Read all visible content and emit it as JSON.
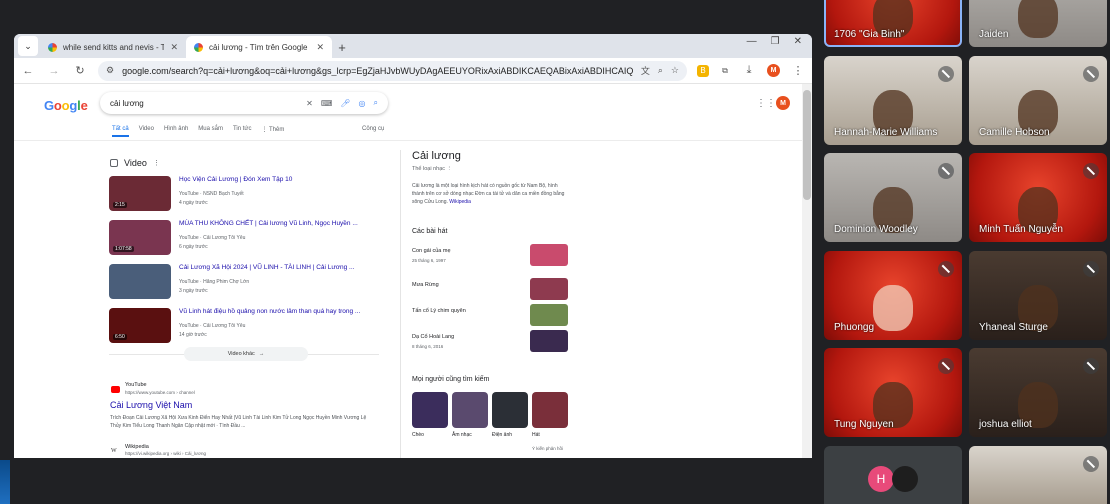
{
  "tabs": [
    {
      "title": "while send kitts and nevis - Tìm",
      "active": false
    },
    {
      "title": "cải lương - Tìm trên Google",
      "active": true
    }
  ],
  "url": "google.com/search?q=cải+lương&oq=cải+lương&gs_lcrp=EgZjaHJvbWUyDAgAEEUYORixAxiABDIKCAEQABixAxiABDIHCAIQABiA...",
  "google": {
    "logo": "Google",
    "query": "cải lương",
    "avatar": "M",
    "tabs": [
      "Tất cả",
      "Video",
      "Hình ảnh",
      "Mua sắm",
      "Tin tức",
      "⋮ Thêm"
    ],
    "tools": "Công cụ"
  },
  "videos": {
    "heading": "Video",
    "items": [
      {
        "title": "Học Viện Cải Lương | Đón Xem Tập 10",
        "source": "YouTube · NSND Bạch Tuyết",
        "date": "4 ngày trước",
        "duration": "2:15",
        "color": "#6b2a35"
      },
      {
        "title": "MÙA THU KHÔNG CHẾT | Cải lương Vũ Linh, Ngọc Huyền ...",
        "source": "YouTube · Cải Lương Tôi Yêu",
        "date": "6 ngày trước",
        "duration": "1:07:58",
        "color": "#7a3550"
      },
      {
        "title": "Cải Lương Xã Hội 2024 | VŨ LINH - TÀI LINH | Cải Lương ...",
        "source": "YouTube · Hãng Phim Chợ Lớn",
        "date": "3 ngày trước",
        "duration": "",
        "color": "#4a5e7a"
      },
      {
        "title": "Vũ Linh hát điệu hồ quảng non nước lâm than quá hay trong ...",
        "source": "YouTube · Cải Lương Tôi Yêu",
        "date": "14 giờ trước",
        "duration": "6:50",
        "color": "#5a1010"
      }
    ],
    "more": "Video khác"
  },
  "result_youtube": {
    "source": "YouTube",
    "url": "https://www.youtube.com › channel",
    "title": "Cải Lương Việt Nam",
    "snippet": "Trích Đoạn Cải Lương Xã Hội Xưa Kinh Điển Hay Nhất |Vũ Linh Tài Linh Kim Tử Long Ngọc Huyền Minh Vương Lệ Thủy Kim Tiểu Long Thanh Ngân Cập nhật mới · Tình Đầu ..."
  },
  "result_wiki": {
    "source": "Wikipedia",
    "url": "https://vi.wikipedia.org › wiki › Cải_lương"
  },
  "knowledge": {
    "title": "Cải lương",
    "subtitle": "Thể loại nhạc ⋮",
    "description": "Cải lương là một loại hình kịch hát có nguồn gốc từ Nam Bộ, hình thành trên cơ sở dòng nhạc Đờn ca tài tử và dân ca miền đồng bằng sông Cửu Long.",
    "wiki_link": "Wikipedia",
    "songs_heading": "Các bài hát",
    "songs": [
      {
        "name": "Con gái của mẹ",
        "date": "25 tháng 6, 1997",
        "color": "#c94b6d"
      },
      {
        "name": "Mưa Rừng",
        "date": "",
        "color": "#8e3a4f"
      },
      {
        "name": "Tấn cổ Lý chim quyên",
        "date": "",
        "color": "#6f8a4e"
      },
      {
        "name": "Dạ Cổ Hoài Lang",
        "date": "8 tháng 6, 2016",
        "color": "#3a2a4f"
      }
    ],
    "people_heading": "Mọi người cũng tìm kiếm",
    "people": [
      {
        "name": "Chèo",
        "color": "#3b2d5c"
      },
      {
        "name": "Âm nhạc",
        "color": "#5a4a6e"
      },
      {
        "name": "Điện ảnh",
        "color": "#2b2f36"
      },
      {
        "name": "Hát",
        "color": "#7a2f3a"
      }
    ],
    "more": "Ý kiến phản hồi"
  },
  "participants": [
    {
      "name": "1706 \"Gia Binh\"",
      "muted": false,
      "bg": "red-bg",
      "selected": true
    },
    {
      "name": "Jaiden",
      "muted": false,
      "bg": "gray-bg",
      "selected": false
    },
    {
      "name": "Hannah-Marie Williams",
      "muted": true,
      "bg": "room-bg",
      "selected": false
    },
    {
      "name": "Camille Hobson",
      "muted": true,
      "bg": "room-bg",
      "selected": false
    },
    {
      "name": "Dominion Woodley",
      "muted": true,
      "bg": "gray-bg",
      "selected": false
    },
    {
      "name": "Minh Tuấn Nguyễn",
      "muted": true,
      "bg": "red-bg",
      "selected": false
    },
    {
      "name": "Phuongg",
      "muted": true,
      "bg": "red-bg",
      "selected": false
    },
    {
      "name": "Yhaneal Sturge",
      "muted": true,
      "bg": "dark-bg",
      "selected": false
    },
    {
      "name": "Tung Nguyen",
      "muted": true,
      "bg": "red-bg",
      "selected": false
    },
    {
      "name": "joshua elliot",
      "muted": true,
      "bg": "dark-bg",
      "selected": false
    }
  ],
  "bottom_avatar": "H"
}
